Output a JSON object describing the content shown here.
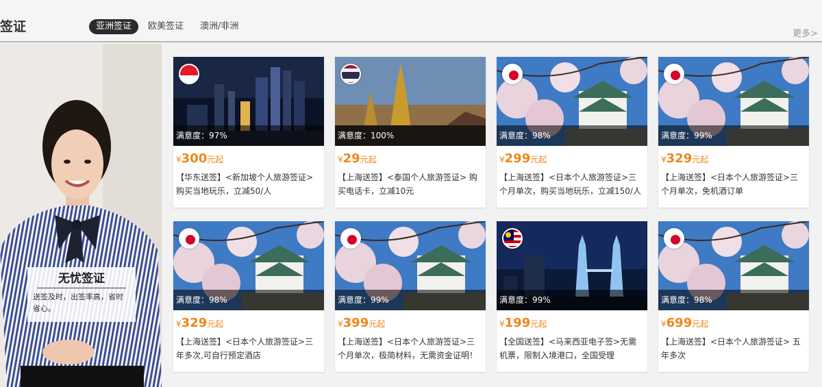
{
  "header": {
    "section_title": "签证",
    "tabs": [
      {
        "label": "亚洲签证",
        "active": true
      },
      {
        "label": "欧美签证",
        "active": false
      },
      {
        "label": "澳洲/非洲",
        "active": false
      }
    ],
    "more_label": "更多>"
  },
  "promo": {
    "title": "无忧签证",
    "description": "送签及时，出签率高，省时省心。"
  },
  "colors": {
    "price": "#f08519",
    "active_tab": "#2b2b2b"
  },
  "cards": [
    {
      "flag": "singapore-flag",
      "scene": "city-night",
      "satisfaction": "满意度：97%",
      "currency": "¥",
      "price": "300",
      "unit": "元起",
      "title": "【华东送签】<新加坡个人旅游签证>购买当地玩乐，立减50/人"
    },
    {
      "flag": "thailand-flag",
      "scene": "temple",
      "satisfaction": "满意度：100%",
      "currency": "¥",
      "price": "29",
      "unit": "元起",
      "title": "【上海送签】<泰国个人旅游签证> 购买电话卡，立减10元"
    },
    {
      "flag": "japan-flag",
      "scene": "castle-sakura",
      "satisfaction": "满意度：98%",
      "currency": "¥",
      "price": "299",
      "unit": "元起",
      "title": "【上海送签】<日本个人旅游签证>三个月单次，购买当地玩乐，立减150/人"
    },
    {
      "flag": "japan-flag",
      "scene": "castle-sakura",
      "satisfaction": "满意度：99%",
      "currency": "¥",
      "price": "329",
      "unit": "元起",
      "title": "【上海送签】<日本个人旅游签证>三个月单次，免机酒订单"
    },
    {
      "flag": "japan-flag",
      "scene": "castle-sakura",
      "satisfaction": "满意度：98%",
      "currency": "¥",
      "price": "329",
      "unit": "元起",
      "title": "【上海送签】<日本个人旅游签证>三年多次,可自行预定酒店"
    },
    {
      "flag": "japan-flag",
      "scene": "castle-sakura",
      "satisfaction": "满意度：99%",
      "currency": "¥",
      "price": "399",
      "unit": "元起",
      "title": "【上海送签】<日本个人旅游签证>三个月单次，极简材料，无需资金证明！"
    },
    {
      "flag": "malaysia-flag",
      "scene": "twin-towers",
      "satisfaction": "满意度：99%",
      "currency": "¥",
      "price": "199",
      "unit": "元起",
      "title": "【全国送签】<马来西亚电子签>无需机票，限制入境港口，全国受理"
    },
    {
      "flag": "japan-flag",
      "scene": "castle-sakura",
      "satisfaction": "满意度：98%",
      "currency": "¥",
      "price": "699",
      "unit": "元起",
      "title": "【上海送签】<日本个人旅游签证> 五年多次"
    }
  ]
}
